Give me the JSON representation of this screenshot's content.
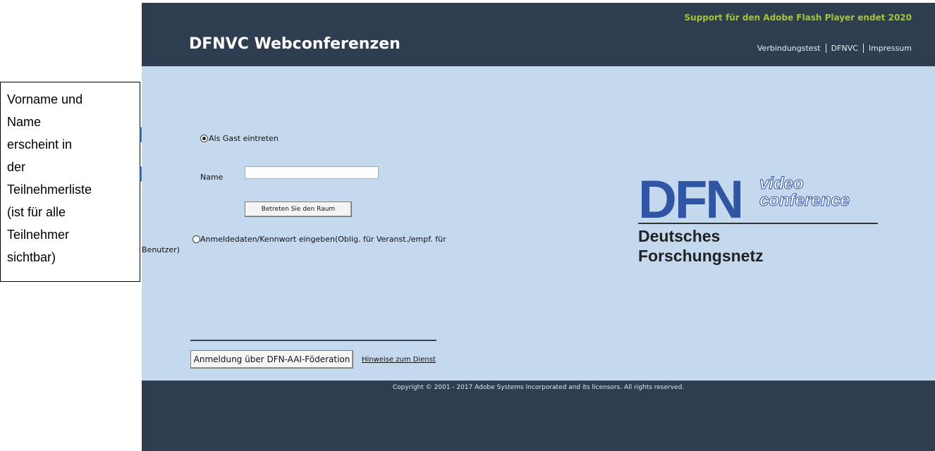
{
  "callout": {
    "lines": [
      "Vorname und",
      "Name",
      "erscheint in",
      "der",
      "Teilnehmerliste",
      "(ist für alle",
      "Teilnehmer",
      "sichtbar)"
    ]
  },
  "header": {
    "support_notice": "Support für den Adobe Flash Player endet 2020",
    "app_title": "DFNVC Webconferenzen",
    "links": [
      "Verbindungstest",
      "DFNVC",
      "Impressum"
    ]
  },
  "login": {
    "guest_option": "Als Gast eintreten",
    "guest_selected": true,
    "name_label": "Name",
    "name_value": "",
    "enter_button": "Betreten Sie den Raum",
    "credentials_option_line1": "Anmeldedaten/Kennwort eingeben(Oblig. für Veranst./empf. für",
    "credentials_option_line2": "Benutzer)",
    "credentials_selected": false,
    "aai_button": "Anmeldung über DFN-AAI-Föderation",
    "hint_link": "Hinweise zum Dienst"
  },
  "logo": {
    "mark": "DFN",
    "word1": "video",
    "word2": "conference",
    "org_line1": "Deutsches",
    "org_line2": "Forschungsnetz"
  },
  "footer": {
    "copyright": "Copyright © 2001 - 2017 Adobe Systems Incorporated and its licensors. All rights reserved."
  },
  "colors": {
    "header_bg": "#2e3e50",
    "main_bg": "#c4d8ee",
    "support_text": "#a6c43a",
    "logo_blue": "#2f55a4",
    "arrow_fill": "#4f81bd"
  }
}
